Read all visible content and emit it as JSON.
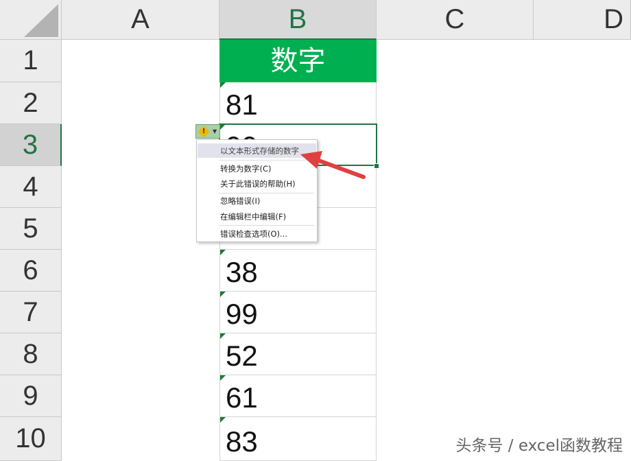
{
  "columns": [
    "A",
    "B",
    "C",
    "D"
  ],
  "rows": [
    "1",
    "2",
    "3",
    "4",
    "5",
    "6",
    "7",
    "8",
    "9",
    "10"
  ],
  "column_b": {
    "header": "数字",
    "values": [
      "81",
      "99",
      "",
      "",
      "38",
      "99",
      "52",
      "61",
      "83"
    ]
  },
  "error_menu": {
    "title": "以文本形式存储的数字",
    "items": [
      "转换为数字(C)",
      "关于此错误的帮助(H)",
      "忽略错误(I)",
      "在编辑栏中编辑(F)",
      "错误检查选项(O)..."
    ]
  },
  "watermark": "头条号 / excel函数教程",
  "colors": {
    "header_green": "#00b050",
    "selection_green": "#217346",
    "arrow_red": "#e04040"
  }
}
